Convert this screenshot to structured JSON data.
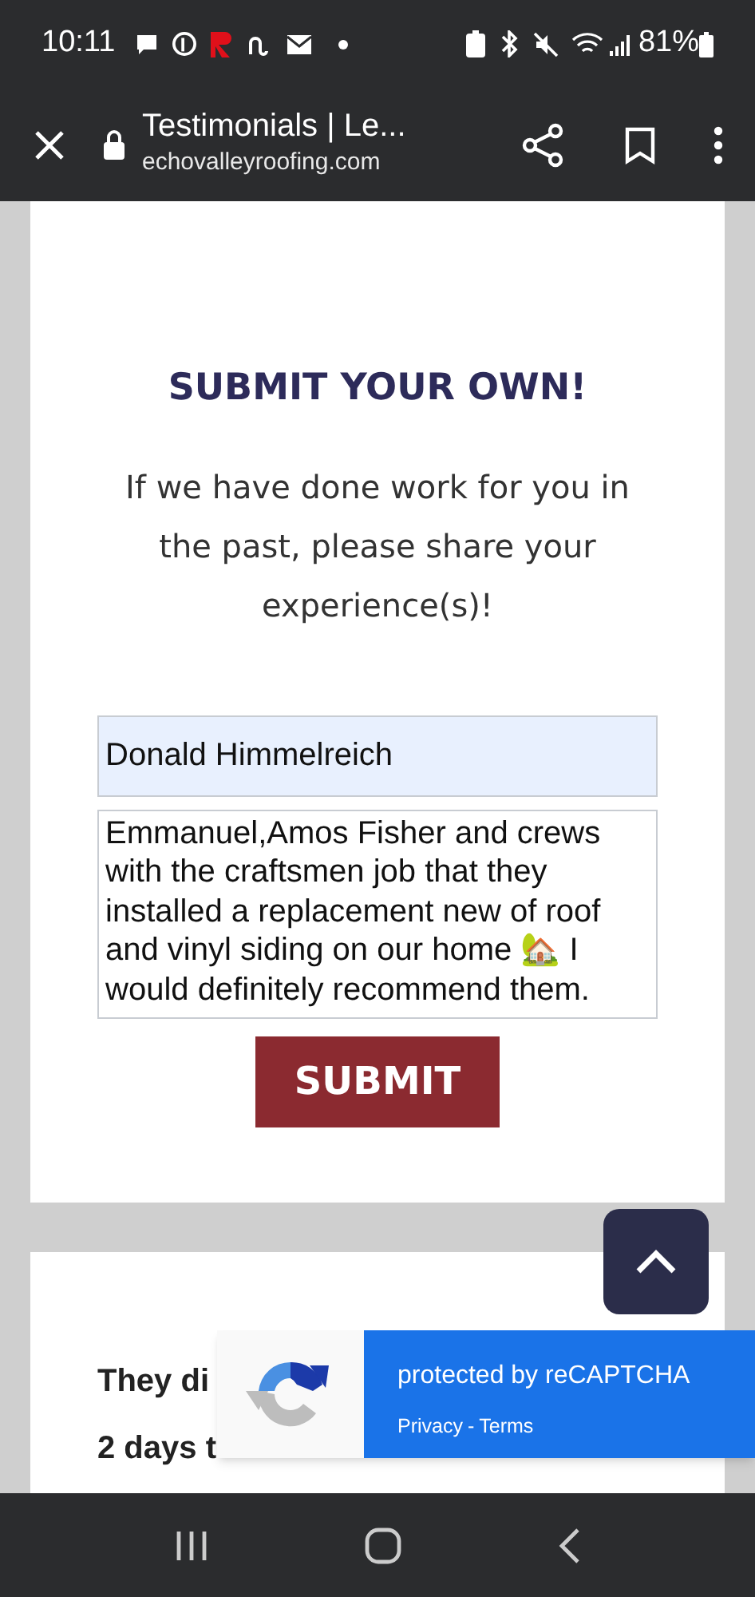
{
  "status_bar": {
    "time": "10:11",
    "battery": "81%"
  },
  "toolbar": {
    "title": "Testimonials | Le...",
    "url": "echovalleyroofing.com"
  },
  "form": {
    "heading": "SUBMIT YOUR OWN!",
    "intro": "If we have done work for you in the past, please share your experience(s)!",
    "name_field": {
      "value": "Donald Himmelreich"
    },
    "message_field": {
      "value": "Emmanuel,Amos Fisher and crews with the craftsmen job that they installed a replacement new of roof and vinyl siding on our home 🏡 I would definitely recommend them."
    },
    "submit": "SUBMIT"
  },
  "testimonial": {
    "lines": [
      "They di",
      "2 days t"
    ]
  },
  "recaptcha": {
    "title": "protected by reCAPTCHA",
    "links": [
      "Privacy",
      "Terms"
    ],
    "separator": "-"
  }
}
